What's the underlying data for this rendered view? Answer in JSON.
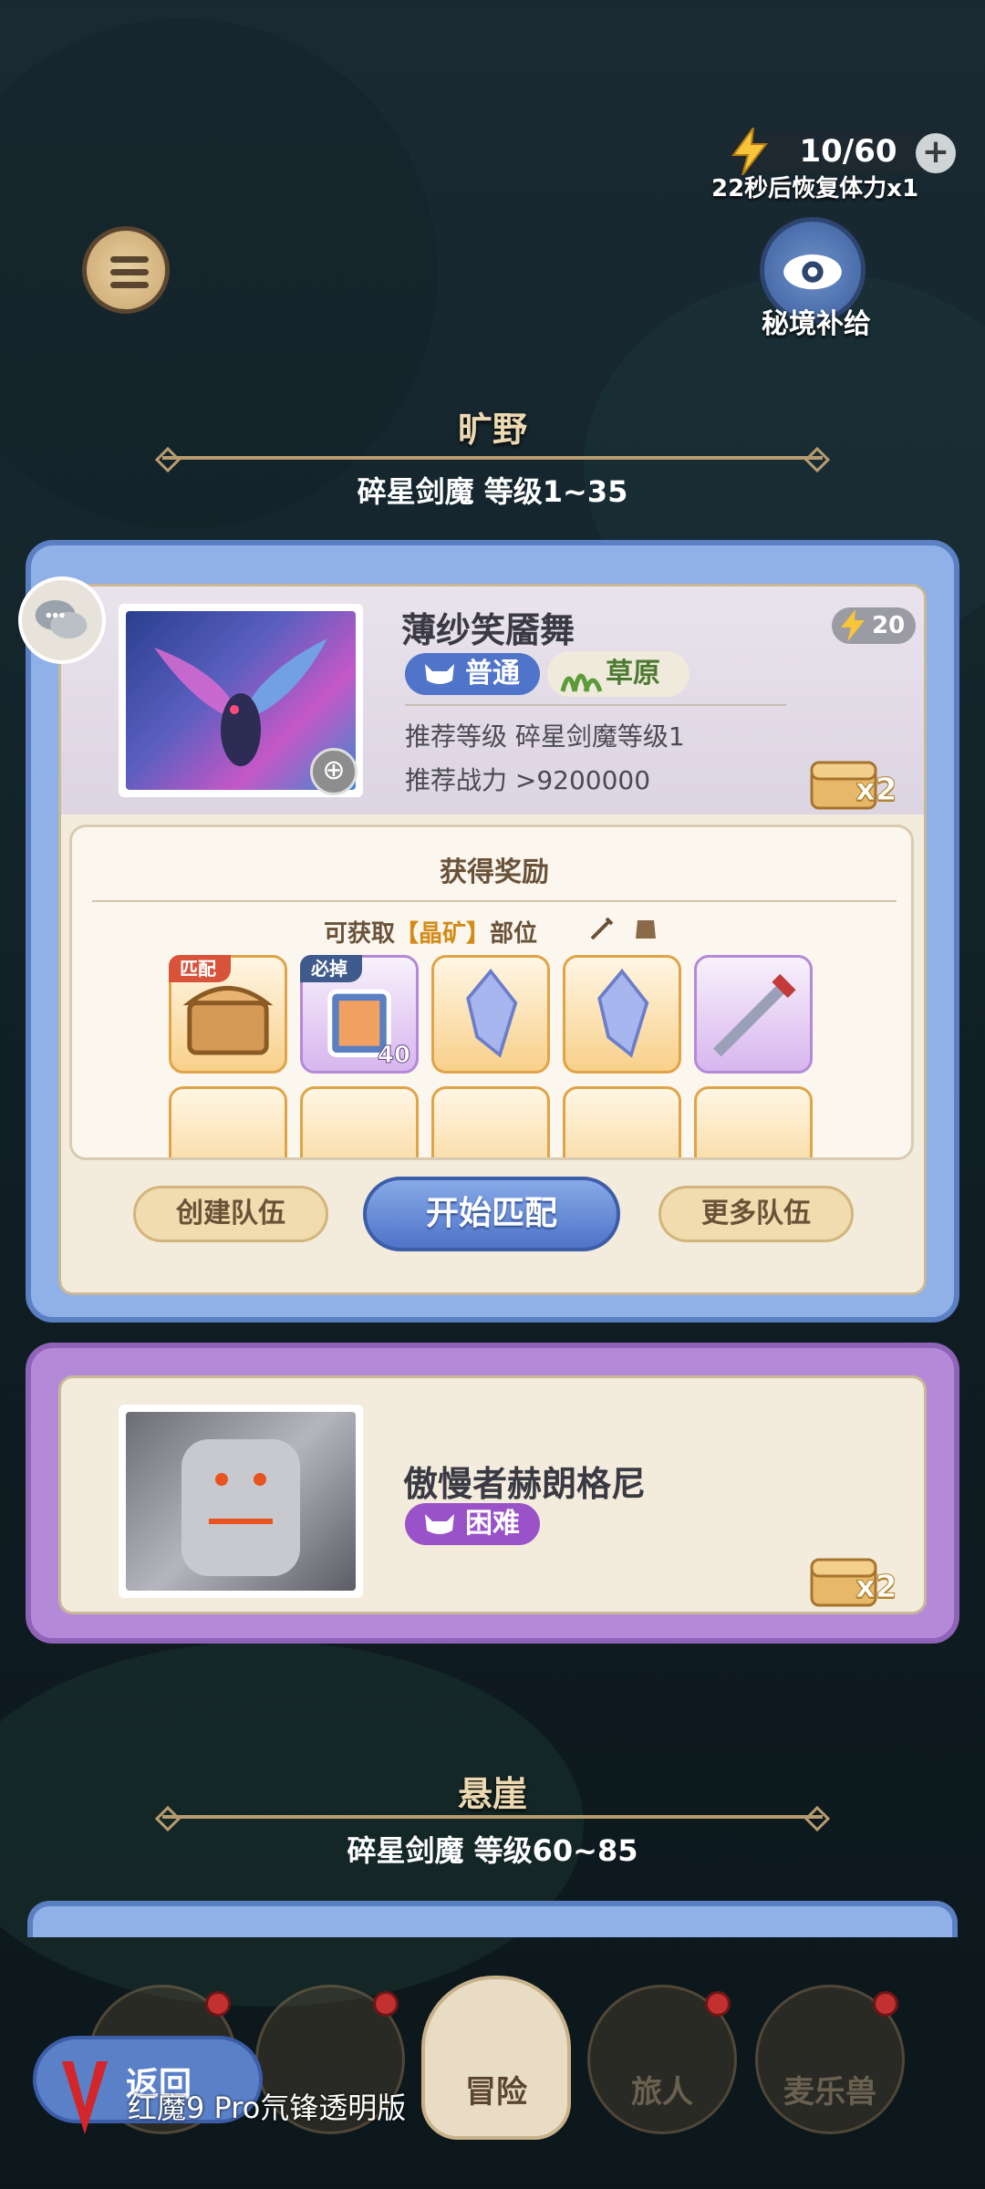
{
  "energy": {
    "value": "10/60",
    "plus": "+",
    "note": "22秒后恢复体力x1"
  },
  "supply": {
    "label": "秘境补给"
  },
  "region1": {
    "title": "旷野",
    "subtitle": "碎星剑魔  等级1~35"
  },
  "card1": {
    "name": "薄纱笑靥舞",
    "cost": "20",
    "difficulty": "普通",
    "terrain": "草原",
    "recommend_level": "推荐等级 碎星剑魔等级1",
    "recommend_power": "推荐战力  >9200000",
    "chest_multiplier": "x2",
    "rewards": {
      "title": "获得奖励",
      "avail_prefix": "可获取",
      "avail_highlight": "【晶矿】",
      "avail_suffix": "部位",
      "items": [
        {
          "badge": "匹配",
          "count": ""
        },
        {
          "badge": "必掉",
          "count": "40"
        },
        {
          "badge": "",
          "count": ""
        },
        {
          "badge": "",
          "count": ""
        },
        {
          "badge": "",
          "count": ""
        }
      ]
    },
    "buttons": {
      "create": "创建队伍",
      "start": "开始匹配",
      "more": "更多队伍"
    }
  },
  "card2": {
    "name": "傲慢者赫朗格尼",
    "difficulty": "困难",
    "chest_multiplier": "x2"
  },
  "region2": {
    "title": "悬崖",
    "subtitle": "碎星剑魔  等级60~85"
  },
  "nav": {
    "items": [
      {
        "label": "",
        "dot": true
      },
      {
        "label": "",
        "dot": true
      },
      {
        "label": "冒险",
        "dot": false,
        "active": true
      },
      {
        "label": "旅人",
        "dot": true
      },
      {
        "label": "麦乐兽",
        "dot": true
      }
    ]
  },
  "back": {
    "label": "返回"
  },
  "watermark": "红魔9 Pro氘锋透明版",
  "colors": {
    "accent_blue": "#4f74c9",
    "accent_purple": "#9a52c8",
    "notice_red": "#c23030"
  }
}
